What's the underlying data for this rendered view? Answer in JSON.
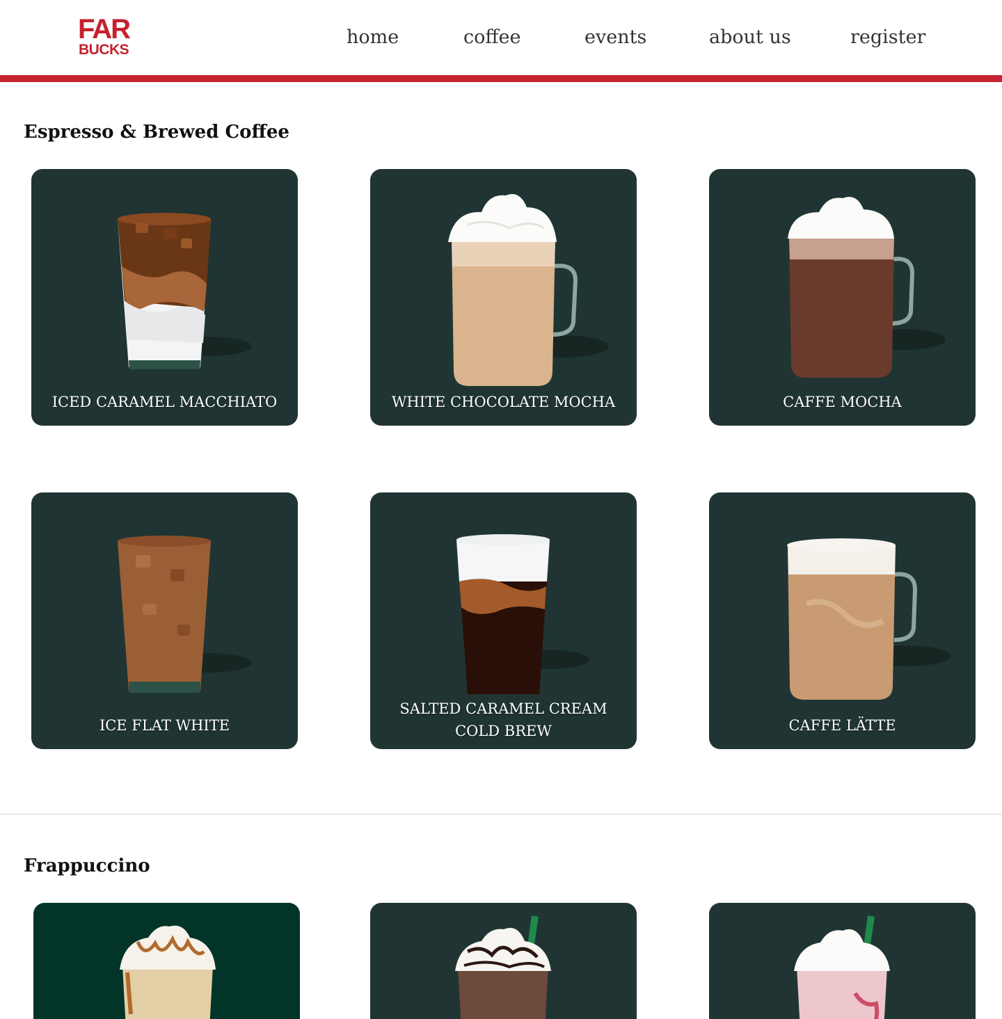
{
  "brand": {
    "line1": "FAR",
    "line2": "BUCKS",
    "color": "#c4222e"
  },
  "nav": {
    "items": [
      {
        "label": "home"
      },
      {
        "label": "coffee"
      },
      {
        "label": "events"
      },
      {
        "label": "about us"
      },
      {
        "label": "register"
      }
    ]
  },
  "sections": [
    {
      "title": "Espresso & Brewed Coffee",
      "items": [
        {
          "name": "ICED CARAMEL MACCHIATO",
          "drink_icon": "iced-latte-glass-icon"
        },
        {
          "name": "WHITE CHOCOLATE MOCHA",
          "drink_icon": "whipped-mug-icon"
        },
        {
          "name": "CAFFE MOCHA",
          "drink_icon": "mocha-mug-icon"
        },
        {
          "name": "ICE FLAT WHITE",
          "drink_icon": "iced-coffee-glass-icon"
        },
        {
          "name": "SALTED CARAMEL CREAM COLD BREW",
          "drink_icon": "cold-brew-glass-icon"
        },
        {
          "name": "CAFFE LÄTTE",
          "drink_icon": "latte-mug-icon"
        }
      ]
    },
    {
      "title": "Frappuccino",
      "items": [
        {
          "name": "",
          "drink_icon": "caramel-frappuccino-icon"
        },
        {
          "name": "",
          "drink_icon": "chocolate-frappuccino-icon"
        },
        {
          "name": "",
          "drink_icon": "strawberry-frappuccino-icon"
        }
      ]
    }
  ],
  "colors": {
    "card": "#203533",
    "card_alt": "#033428",
    "accent": "#c4222e"
  }
}
